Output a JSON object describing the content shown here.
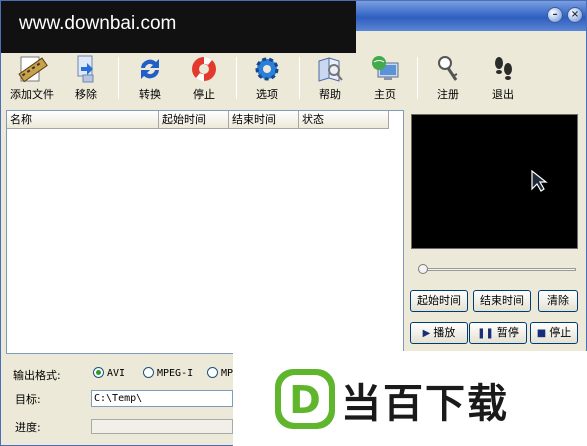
{
  "watermark": {
    "text": "www.downbai.com"
  },
  "toolbar": {
    "add_file": "添加文件",
    "remove": "移除",
    "convert": "转换",
    "stop": "停止",
    "options": "选项",
    "help": "帮助",
    "home": "主页",
    "register": "注册",
    "exit": "退出"
  },
  "file_list": {
    "columns": [
      "名称",
      "起始时间",
      "结束时间",
      "状态"
    ]
  },
  "player": {
    "start_time_btn": "起始时间",
    "end_time_btn": "结束时间",
    "clear_btn": "清除",
    "play_btn": "播放",
    "pause_btn": "暂停",
    "stop_btn": "停止"
  },
  "output": {
    "format_label": "输出格式:",
    "formats": [
      "AVI",
      "MPEG-I",
      "MP"
    ],
    "selected": "AVI",
    "target_label": "目标:",
    "target_value": "C:\\Temp\\",
    "progress_label": "进度:"
  },
  "brand": {
    "text": "当百下载",
    "logo_letter": "D"
  },
  "colors": {
    "titlebar": "#3b6bc9",
    "logo_green": "#5fb52b",
    "accent": "#1a2d7a"
  }
}
